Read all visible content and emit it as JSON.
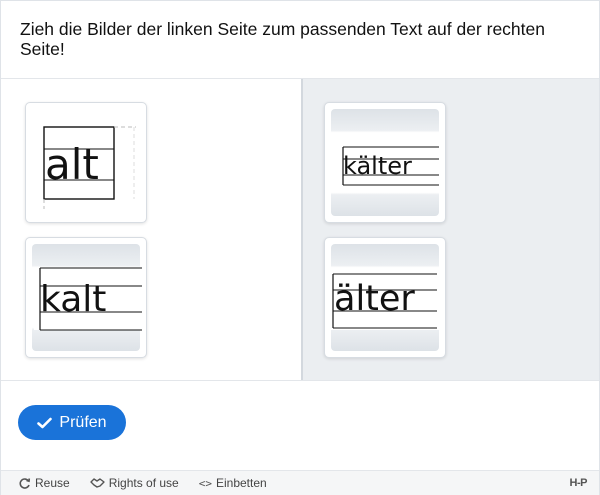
{
  "task": {
    "question": "Zieh die Bilder der linken Seite zum passenden Text auf der rechten Seite!"
  },
  "left_cards": [
    {
      "word": "alt"
    },
    {
      "word": "kalt"
    }
  ],
  "right_cards": [
    {
      "word": "kälter"
    },
    {
      "word": "älter"
    }
  ],
  "actions": {
    "check_label": "Prüfen"
  },
  "footer": {
    "reuse_label": "Reuse",
    "rights_label": "Rights of use",
    "embed_label": "Einbetten",
    "logo_text": "H-P"
  },
  "colors": {
    "accent": "#1a73d9",
    "dropzone_bg": "#ebeef1"
  }
}
